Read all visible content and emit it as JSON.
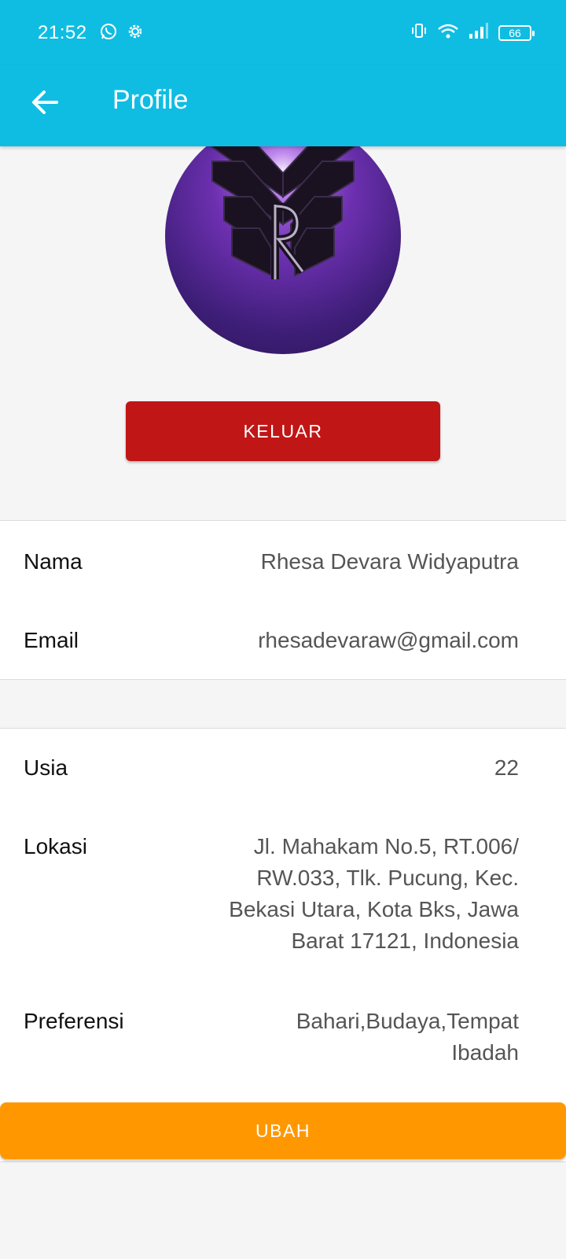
{
  "status_bar": {
    "time": "21:52",
    "battery_level": "66",
    "icons": [
      "whatsapp-icon",
      "settings-icon",
      "vibrate-icon",
      "wifi-icon",
      "signal-icon",
      "battery-icon"
    ]
  },
  "app_bar": {
    "title": "Profile",
    "back_icon": "arrow-left-icon",
    "background": "#0fbde3"
  },
  "profile": {
    "avatar_icon": "profile-avatar-logo",
    "logout_label": "KELUAR",
    "logout_color": "#c11616"
  },
  "account": {
    "name_label": "Nama",
    "name_value": "Rhesa Devara Widyaputra",
    "email_label": "Email",
    "email_value": "rhesadevaraw@gmail.com"
  },
  "details": {
    "age_label": "Usia",
    "age_value": "22",
    "location_label": "Lokasi",
    "location_lines": [
      "Jl. Mahakam No.5, RT.006/",
      "RW.033, Tlk. Pucung, Kec.",
      "Bekasi Utara, Kota Bks, Jawa",
      "Barat 17121, Indonesia"
    ],
    "preference_label": "Preferensi",
    "preference_lines": [
      "Bahari,Budaya,Tempat",
      "Ibadah"
    ]
  },
  "actions": {
    "edit_label": "UBAH",
    "edit_color": "#ff9800"
  }
}
